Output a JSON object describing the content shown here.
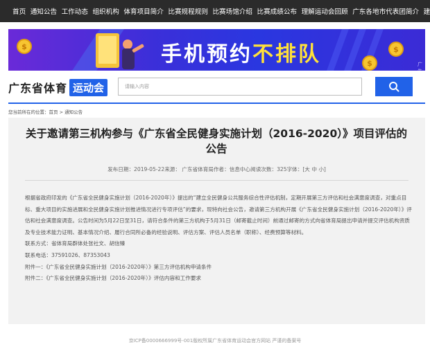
{
  "nav": {
    "items": [
      "首页",
      "通知公告",
      "工作动态",
      "组织机构",
      "体育项目简介",
      "比赛规程规则",
      "比赛场馆介绍",
      "比赛成绩公布",
      "理解运动会回顾",
      "广东各地市代表团简介",
      "建议邮箱"
    ]
  },
  "banner": {
    "slogan_main": "手机预约",
    "slogan_highlight": "不排队",
    "coin_symbol": "$",
    "corner_text": "广告"
  },
  "header": {
    "logo_text": "广东省体育",
    "logo_badge": "运动会",
    "search_placeholder": "请输入内容",
    "search_icon": "search-icon"
  },
  "breadcrumb": {
    "prefix": "您当前所在的位置：",
    "home": "首页",
    "separator": " > ",
    "current": "通知公告"
  },
  "article": {
    "title": "关于邀请第三机构参与《广东省全民健身实施计划（2016-2020）》项目评估的公告",
    "meta": "发布日期：2019-05-22来源：  广东省体育局作者：信息中心阅读次数：325字体：[大 中 小]",
    "paragraph": "根据省政府印发的《广东省全民健身实施计划（2016-2020年）》提出的“建立全民健身公共服务综合性评估机制，定期开展第三方评估和社会满意度调查，对重点目标、重大项目的实施进展和全民健身实施计划推进情况进行专项评估”的要求，现特向社会公告，邀请第三方机构开展《广东省全民健身实施计划（2016-2020年）》评估和社会满意度调查。公告时间为5月22日至31日，请符合条件的第三方机构于5月31日（邮寄截止时间）前通过邮寄的方式向省体育局提出申请并提交评估机构资质及专业技术能力证明、基本情况介绍、履行合同所必备的经验说明、评估方案、评估人员名单（职称）、经费预算等材料。",
    "contact_person": "联系方式：省体育局群体处张社文、胡信臻",
    "contact_phone": "联系电话：37591026、87353043",
    "attachment1": "附件一：《广东省全民健身实施计划（2016-2020年）》第三方评估机构申请条件",
    "attachment2": "附件二：《广东省全民健身实施计划（2016-2020年）》评估内容和工作要求"
  },
  "footer": {
    "text": "京ICP备0000666999号-001版权所属广东省体育运动会官方网站 严谨的备案号"
  },
  "colors": {
    "nav_bg": "#2b2b2b",
    "accent_blue": "#2162e8",
    "banner_purple": "#5a2bd6",
    "slogan_yellow": "#ffe13a",
    "article_bg": "#f2f2f2"
  }
}
